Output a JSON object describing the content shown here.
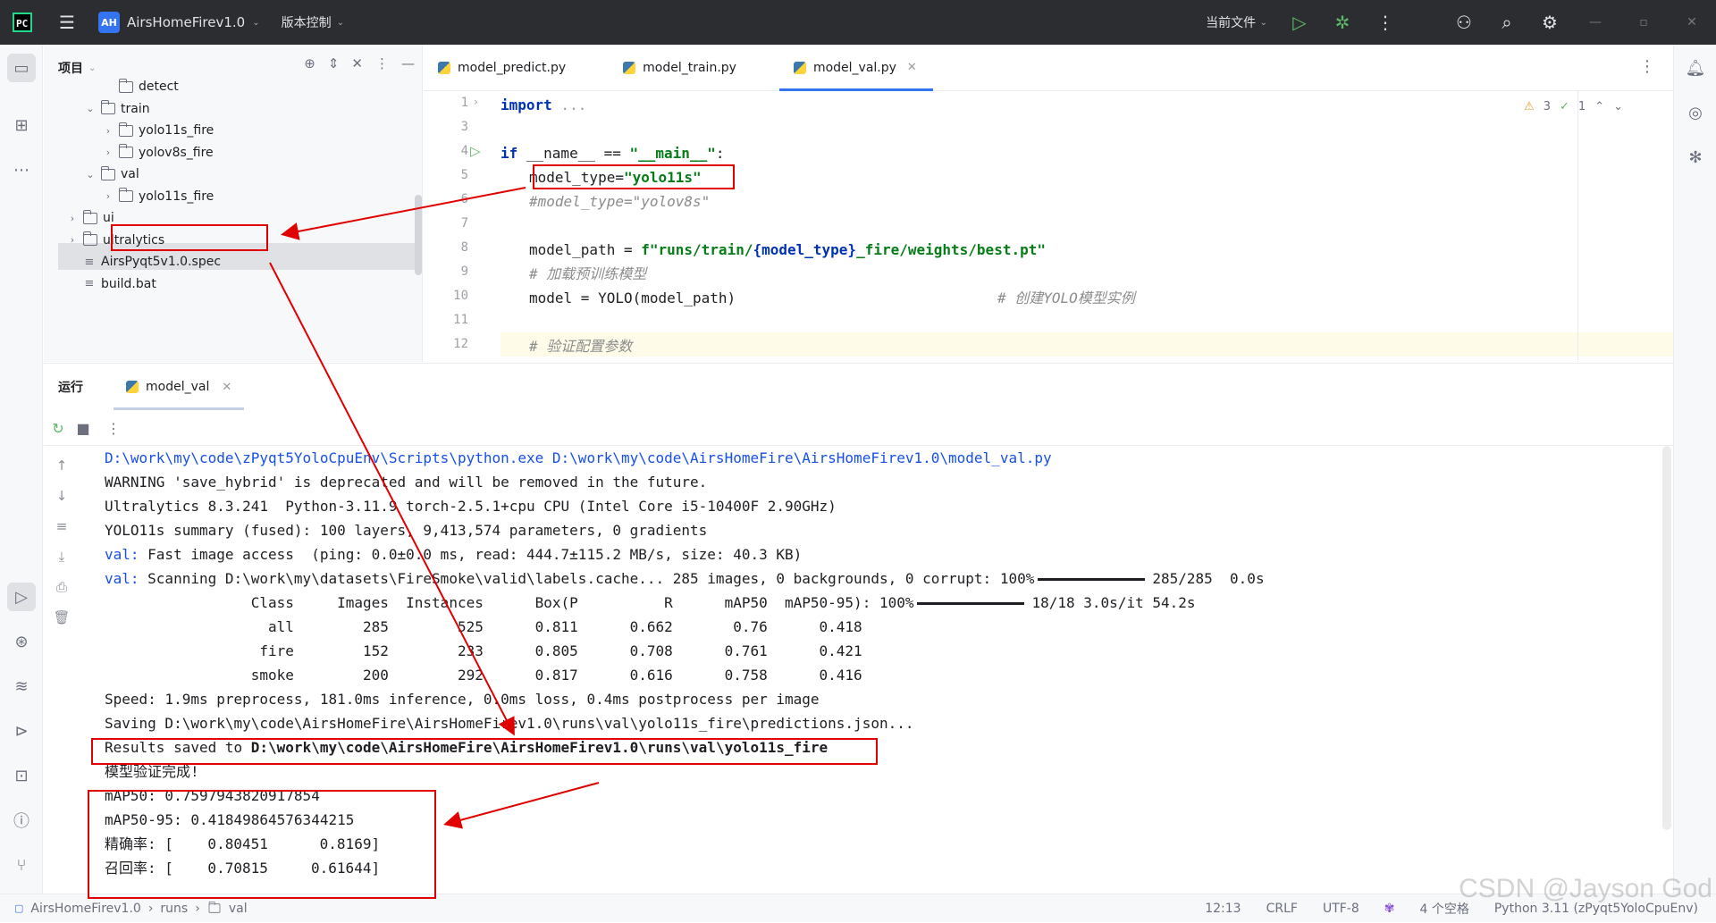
{
  "titlebar": {
    "project_badge": "AH",
    "project_name": "AirsHomeFirev1.0",
    "vcs_label": "版本控制",
    "run_config": "当前文件"
  },
  "project_panel": {
    "title": "项目",
    "tree": [
      {
        "label": "detect",
        "kind": "folder",
        "expanded": false,
        "arrow": ""
      },
      {
        "label": "train",
        "kind": "folder",
        "expanded": true,
        "arrow": "⌄"
      },
      {
        "label": "yolo11s_fire",
        "kind": "folder",
        "expanded": false,
        "arrow": "›"
      },
      {
        "label": "yolov8s_fire",
        "kind": "folder",
        "expanded": false,
        "arrow": "›"
      },
      {
        "label": "val",
        "kind": "folder",
        "expanded": true,
        "arrow": "⌄"
      },
      {
        "label": "yolo11s_fire",
        "kind": "folder",
        "expanded": false,
        "arrow": "›"
      },
      {
        "label": "ui",
        "kind": "folder",
        "expanded": false,
        "arrow": "›"
      },
      {
        "label": "ultralytics",
        "kind": "folder",
        "expanded": false,
        "arrow": "›"
      },
      {
        "label": "AirsPyqt5v1.0.spec",
        "kind": "file",
        "arrow": ""
      },
      {
        "label": "build.bat",
        "kind": "file",
        "arrow": ""
      }
    ]
  },
  "editor": {
    "tabs": [
      {
        "label": "model_predict.py",
        "active": false
      },
      {
        "label": "model_train.py",
        "active": false
      },
      {
        "label": "model_val.py",
        "active": true
      }
    ],
    "warnings": "3",
    "checks": "1",
    "line_numbers": [
      "1",
      "3",
      "4",
      "5",
      "6",
      "7",
      "8",
      "9",
      "10",
      "11",
      "12"
    ],
    "lines": {
      "l1_kw": "import",
      "l1_rest": " ...",
      "l4_kw": "if",
      "l4_mid": " __name__ == ",
      "l4_str": "\"__main__\"",
      "l4_end": ":",
      "l5_a": "model_type=",
      "l5_str": "\"yolo11s\"",
      "l6_cm": "#model_type=\"yolov8s\"",
      "l8_a": "model_path = ",
      "l8_str1": "f\"runs/train/",
      "l8_mid": "{model_type}",
      "l8_str2": "_fire/weights/best.pt\"",
      "l9_cm": "# 加载预训练模型",
      "l10_a": "model = YOLO(model_path)",
      "l10_cm": "# 创建YOLO模型实例",
      "l12_cm": "# 验证配置参数"
    }
  },
  "run_panel": {
    "title": "运行",
    "tab_label": "model_val",
    "output": {
      "o1": "D:\\work\\my\\code\\zPyqt5YoloCpuEnv\\Scripts\\python.exe D:\\work\\my\\code\\AirsHomeFire\\AirsHomeFirev1.0\\model_val.py",
      "o2": "WARNING 'save_hybrid' is deprecated and will be removed in the future.",
      "o3": "Ultralytics 8.3.241  Python-3.11.9 torch-2.5.1+cpu CPU (Intel Core i5-10400F 2.90GHz)",
      "o4": "YOLO11s summary (fused): 100 layers, 9,413,574 parameters, 0 gradients",
      "o5_prefix": "val:",
      "o5_rest": " Fast image access  (ping: 0.0±0.0 ms, read: 444.7±115.2 MB/s, size: 40.3 KB)",
      "o6_prefix": "val:",
      "o6_rest": " Scanning D:\\work\\my\\datasets\\FireSmoke\\valid\\labels.cache... 285 images, 0 backgrounds, 0 corrupt: 100%",
      "o6_tail": "285/285  0.0s",
      "o7": "                 Class     Images  Instances      Box(P          R      mAP50  mAP50-95): 100%",
      "o7_tail": "18/18 3.0s/it 54.2s",
      "o8": "                   all        285        525      0.811      0.662       0.76      0.418",
      "o9": "                  fire        152        233      0.805      0.708      0.761      0.421",
      "o10": "                 smoke        200        292      0.817      0.616      0.758      0.416",
      "o11": "Speed: 1.9ms preprocess, 181.0ms inference, 0.0ms loss, 0.4ms postprocess per image",
      "o12": "Saving D:\\work\\my\\code\\AirsHomeFire\\AirsHomeFirev1.0\\runs\\val\\yolo11s_fire\\predictions.json...",
      "o13_prefix": "Results saved to ",
      "o13_path": "D:\\work\\my\\code\\AirsHomeFire\\AirsHomeFirev1.0\\runs\\val\\yolo11s_fire",
      "o14": "模型验证完成!",
      "o15": "mAP50: 0.7597943820917854",
      "o16": "mAP50-95: 0.41849864576344215",
      "o17": "精确率: [    0.80451      0.8169]",
      "o18": "召回率: [    0.70815     0.61644]"
    }
  },
  "statusbar": {
    "crumb1": "AirsHomeFirev1.0",
    "crumb2": "runs",
    "crumb3": "val",
    "position": "12:13",
    "line_ending": "CRLF",
    "encoding": "UTF-8",
    "indent": "4 个空格",
    "interpreter": "Python 3.11 (zPyqt5YoloCpuEnv)"
  },
  "watermark": "CSDN @Jayson God",
  "colors": {
    "annotation_red": "#e00000",
    "accent": "#3574f0",
    "keyword": "#0033b3",
    "string": "#067d17"
  }
}
